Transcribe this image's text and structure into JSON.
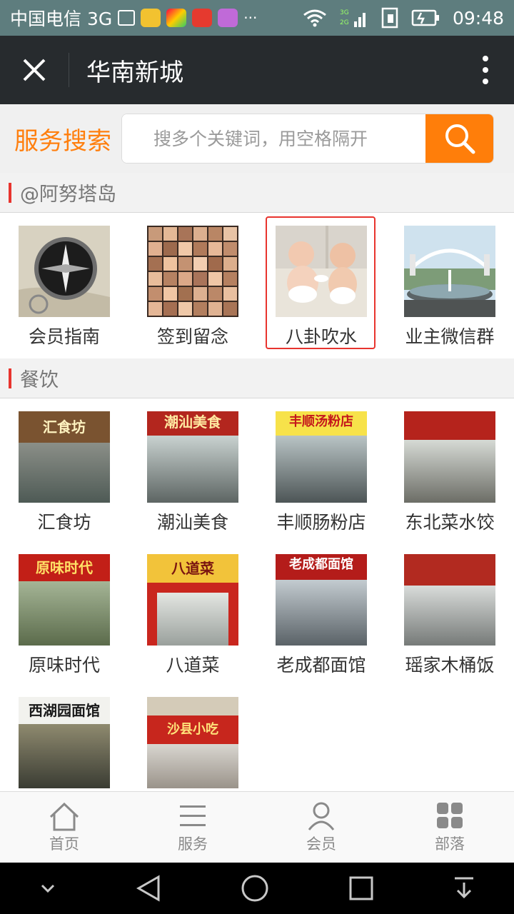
{
  "status_bar": {
    "carrier": "中国电信 3G",
    "time": "09:48",
    "network_small": "3G 2G"
  },
  "header": {
    "title": "华南新城"
  },
  "search": {
    "label": "服务搜索",
    "placeholder": "搜多个关键词，用空格隔开"
  },
  "sections": [
    {
      "title": "@阿努塔岛",
      "items": [
        {
          "label": "会员指南",
          "image": "compass-photo"
        },
        {
          "label": "签到留念",
          "image": "faces-collage-photo"
        },
        {
          "label": "八卦吹水",
          "image": "babies-photo",
          "selected": true
        },
        {
          "label": "业主微信群",
          "image": "fountain-photo"
        }
      ]
    },
    {
      "title": "餐饮",
      "items": [
        {
          "label": "汇食坊",
          "image": "shopfront-photo",
          "sign": "汇食坊"
        },
        {
          "label": "潮汕美食",
          "image": "shopfront-photo",
          "sign": "潮汕美食"
        },
        {
          "label": "丰顺肠粉店",
          "image": "shopfront-photo",
          "sign": "丰顺汤粉店"
        },
        {
          "label": "东北菜水饺",
          "image": "shopfront-photo",
          "sign": ""
        },
        {
          "label": "原味时代",
          "image": "shopfront-photo",
          "sign": "原味时代"
        },
        {
          "label": "八道菜",
          "image": "shopfront-photo",
          "sign": "八道菜"
        },
        {
          "label": "老成都面馆",
          "image": "shopfront-photo",
          "sign": "老成都面馆"
        },
        {
          "label": "瑶家木桶饭",
          "image": "shopfront-photo",
          "sign": ""
        },
        {
          "label": "",
          "image": "shopfront-photo",
          "sign": "西湖园面馆"
        },
        {
          "label": "",
          "image": "shopfront-photo",
          "sign": "沙县小吃"
        }
      ]
    }
  ],
  "tabs": [
    {
      "label": "首页",
      "icon": "home-icon"
    },
    {
      "label": "服务",
      "icon": "menu-icon"
    },
    {
      "label": "会员",
      "icon": "user-icon"
    },
    {
      "label": "部落",
      "icon": "grid-icon"
    }
  ],
  "colors": {
    "accent": "#ff7e0a",
    "section_bar": "#e8342e",
    "header_bg": "#272b2e",
    "status_bg": "#5e7d7e",
    "selected_border": "#e8342e"
  }
}
